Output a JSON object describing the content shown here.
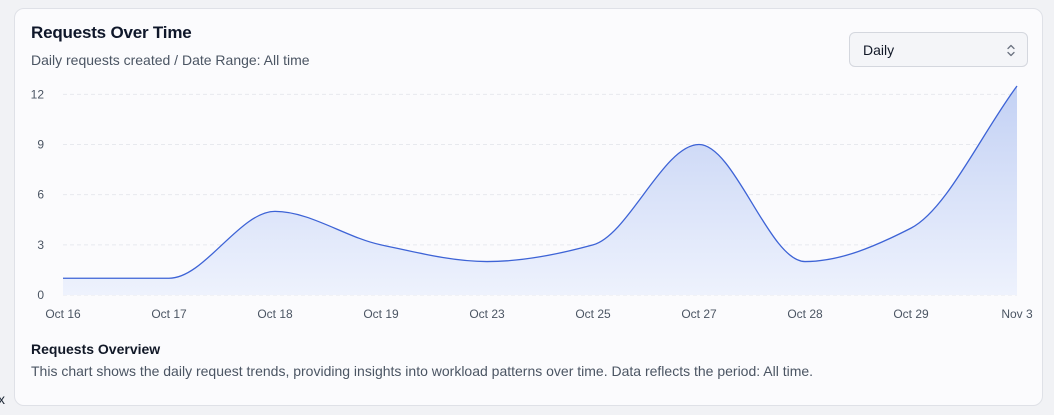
{
  "card": {
    "title": "Requests Over Time",
    "subtitle": "Daily requests created / Date Range: All time",
    "period_select": {
      "value": "Daily",
      "icon": "chevron-up-down-icon"
    },
    "footer_title": "Requests Overview",
    "footer_text": "This chart shows the daily request trends, providing insights into workload patterns over time. Data reflects the period: All time."
  },
  "edge_glyph": "x",
  "colors": {
    "line": "#3d63d6",
    "area_top": "#c3d1f4",
    "area_bottom": "#eef2fd",
    "grid": "#e7e9ee"
  },
  "chart_data": {
    "type": "area",
    "categories": [
      "Oct 16",
      "Oct 17",
      "Oct 18",
      "Oct 19",
      "Oct 23",
      "Oct 25",
      "Oct 27",
      "Oct 28",
      "Oct 29",
      "Nov 3"
    ],
    "series": [
      {
        "values": [
          1,
          1,
          5,
          3,
          2,
          3,
          9,
          2,
          4,
          12.5
        ]
      }
    ],
    "yticks": [
      0,
      3,
      6,
      9,
      12
    ],
    "ylim": [
      0,
      12.5
    ],
    "grid": "horizontal dashed",
    "curve": "smooth",
    "legend": "none"
  }
}
